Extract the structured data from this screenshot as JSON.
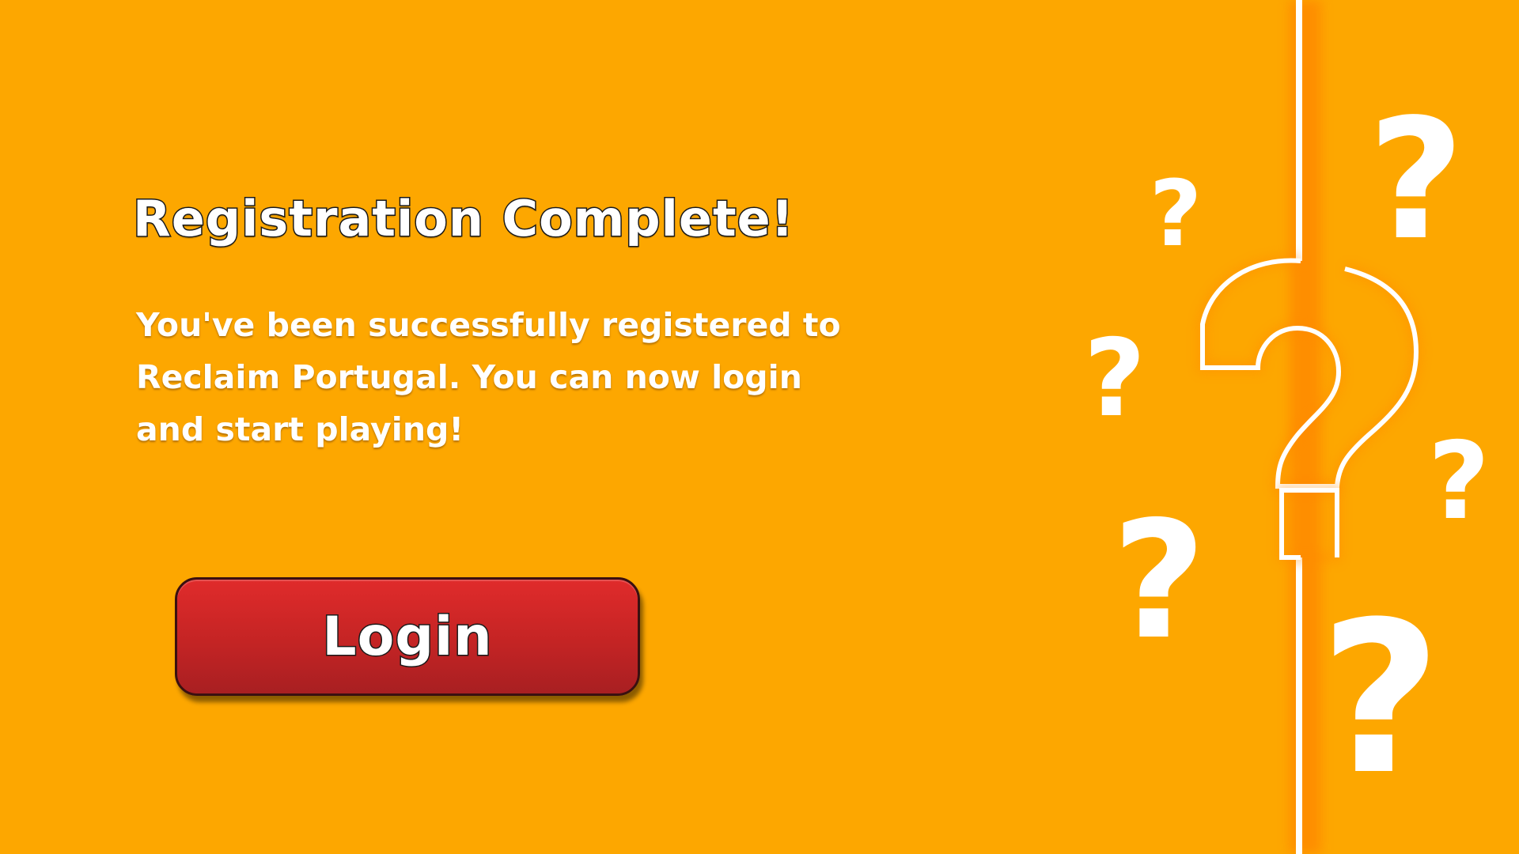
{
  "screen": {
    "title": "Registration Complete!",
    "message": "You've been successfully registered to Reclaim Portugal. You can now login and start playing!"
  },
  "login_button": {
    "label": "Login"
  },
  "decoration": {
    "glyph": "?"
  },
  "colors": {
    "background": "#fda700",
    "button": "#c42424",
    "text": "#ffffff",
    "outline": "#1a1a1a"
  }
}
